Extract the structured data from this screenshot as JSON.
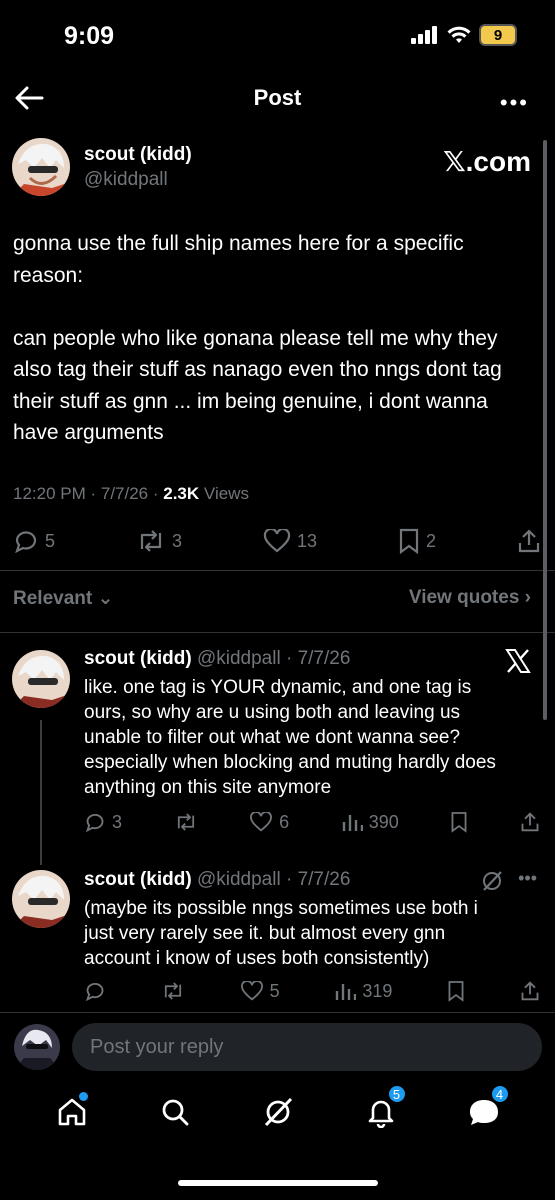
{
  "status_bar": {
    "time": "9:09",
    "battery": "9"
  },
  "nav": {
    "title": "Post"
  },
  "post": {
    "display_name": "scout (kidd)",
    "handle": "@kiddpall",
    "source_badge": "𝕏.com",
    "text": "gonna use the full ship names here for a specific reason:\n\ncan people who like gonana please tell me why they also tag their stuff as nanago even tho nngs dont tag their stuff as gnn ... im being genuine, i dont wanna have arguments",
    "time": "12:20 PM",
    "date": "7/7/26",
    "views_count": "2.3K",
    "views_label": "Views",
    "replies": "5",
    "reposts": "3",
    "likes": "13",
    "bookmarks": "2"
  },
  "filter": {
    "relevant_label": "Relevant",
    "view_quotes_label": "View quotes"
  },
  "replies": [
    {
      "display_name": "scout (kidd)",
      "handle": "@kiddpall",
      "date": "7/7/26",
      "text": "like. one tag is YOUR dynamic, and one tag is ours, so why are u using both and leaving us unable to filter out what we dont wanna see? especially when blocking and muting hardly does anything on this site anymore",
      "replies": "3",
      "likes": "6",
      "views": "390"
    },
    {
      "display_name": "scout (kidd)",
      "handle": "@kiddpall",
      "date": "7/7/26",
      "text": "(maybe its possible nngs sometimes use both i just very rarely see it. but almost every gnn account i know of uses both consistently)",
      "likes": "5",
      "views": "319"
    }
  ],
  "compose": {
    "placeholder": "Post your reply"
  },
  "tabbar": {
    "notifications_badge": "5",
    "messages_badge": "4"
  },
  "colors": {
    "accent": "#1d9bf0",
    "background": "#000000",
    "muted": "#71767b"
  }
}
